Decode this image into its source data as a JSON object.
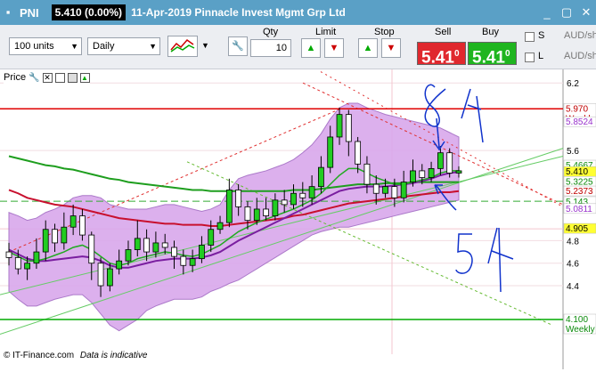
{
  "window": {
    "symbol": "PNI",
    "last": "5.410 (0.00%)",
    "title": "11-Apr-2019 Pinnacle Invest Mgmt Grp Ltd"
  },
  "toolbar": {
    "units": "100 units",
    "period": "Daily",
    "qty_label": "Qty",
    "qty_value": "10",
    "limit_label": "Limit",
    "stop_label": "Stop",
    "sell_label": "Sell",
    "buy_label": "Buy",
    "sell_price": "5.41",
    "sell_sup": "0",
    "buy_price": "5.41",
    "buy_sup": "0",
    "s_label": "S",
    "l_label": "L",
    "audsh1": "AUD/sh",
    "audsh2": "AUD/sh"
  },
  "chart_panel": {
    "label": "Price"
  },
  "chart_data": {
    "type": "line",
    "yticks": [
      {
        "v": 6.2,
        "label": "6.2"
      },
      {
        "v": 5.6,
        "label": "5.6"
      },
      {
        "v": 4.8,
        "label": "4.8"
      },
      {
        "v": 4.6,
        "label": "4.6"
      },
      {
        "v": 4.4,
        "label": "4.4"
      }
    ],
    "ylim": [
      3.95,
      6.32
    ],
    "level_boxes": [
      {
        "v": 5.97,
        "label": "5.970",
        "sub": "Weekly",
        "bg": "#ffffff",
        "fg": "#c00000"
      },
      {
        "v": 5.8524,
        "label": "5.8524",
        "bg": "#ffffff",
        "fg": "#9933cc"
      },
      {
        "v": 5.4667,
        "label": "5.4667",
        "bg": "#ffffff",
        "fg": "#0a8a0a"
      },
      {
        "v": 5.41,
        "label": "5.410",
        "bg": "#ffff33",
        "fg": "#000000"
      },
      {
        "v": 5.3225,
        "label": "5.3225",
        "bg": "#ffffff",
        "fg": "#0a8a0a"
      },
      {
        "v": 5.2373,
        "label": "5.2373",
        "bg": "#ffffff",
        "fg": "#c00000"
      },
      {
        "v": 5.143,
        "label": "5.143",
        "bg": "#ffffff",
        "fg": "#0a8a0a"
      },
      {
        "v": 5.0811,
        "label": "5.0811",
        "bg": "#ffffff",
        "fg": "#9933cc"
      },
      {
        "v": 4.905,
        "label": "4.905",
        "bg": "#ffff33",
        "fg": "#000000"
      },
      {
        "v": 4.1,
        "label": "4.100",
        "sub": "Weekly",
        "bg": "#ffffff",
        "fg": "#0a8a0a"
      }
    ],
    "candles": [
      [
        4.7,
        4.65,
        4.78,
        4.58
      ],
      [
        4.65,
        4.55,
        4.72,
        4.5
      ],
      [
        4.55,
        4.6,
        4.66,
        4.45
      ],
      [
        4.6,
        4.7,
        4.82,
        4.55
      ],
      [
        4.7,
        4.9,
        4.98,
        4.62
      ],
      [
        4.9,
        4.78,
        4.95,
        4.7
      ],
      [
        4.78,
        4.92,
        5.05,
        4.72
      ],
      [
        4.92,
        5.02,
        5.12,
        4.85
      ],
      [
        5.02,
        4.85,
        5.08,
        4.8
      ],
      [
        4.85,
        4.6,
        4.88,
        4.45
      ],
      [
        4.6,
        4.4,
        4.65,
        4.3
      ],
      [
        4.4,
        4.55,
        4.6,
        4.35
      ],
      [
        4.55,
        4.62,
        4.72,
        4.5
      ],
      [
        4.62,
        4.72,
        4.8,
        4.58
      ],
      [
        4.72,
        4.82,
        4.98,
        4.66
      ],
      [
        4.82,
        4.7,
        4.9,
        4.62
      ],
      [
        4.7,
        4.78,
        4.88,
        4.65
      ],
      [
        4.78,
        4.74,
        4.86,
        4.68
      ],
      [
        4.74,
        4.66,
        4.8,
        4.55
      ],
      [
        4.66,
        4.58,
        4.72,
        4.5
      ],
      [
        4.58,
        4.64,
        4.72,
        4.52
      ],
      [
        4.64,
        4.76,
        4.84,
        4.6
      ],
      [
        4.76,
        4.9,
        4.98,
        4.7
      ],
      [
        4.9,
        4.96,
        5.02,
        4.86
      ],
      [
        4.96,
        5.25,
        5.35,
        4.92
      ],
      [
        5.25,
        5.1,
        5.3,
        5.02
      ],
      [
        5.1,
        4.98,
        5.15,
        4.9
      ],
      [
        4.98,
        5.08,
        5.18,
        4.94
      ],
      [
        5.08,
        5.02,
        5.18,
        4.98
      ],
      [
        5.02,
        5.16,
        5.22,
        4.98
      ],
      [
        5.16,
        5.12,
        5.25,
        5.05
      ],
      [
        5.12,
        5.22,
        5.3,
        5.08
      ],
      [
        5.22,
        5.18,
        5.32,
        5.1
      ],
      [
        5.18,
        5.28,
        5.38,
        5.12
      ],
      [
        5.28,
        5.45,
        5.55,
        5.22
      ],
      [
        5.45,
        5.72,
        5.82,
        5.4
      ],
      [
        5.72,
        5.92,
        5.98,
        5.65
      ],
      [
        5.92,
        5.68,
        5.96,
        5.55
      ],
      [
        5.68,
        5.48,
        5.72,
        5.4
      ],
      [
        5.48,
        5.3,
        5.55,
        5.22
      ],
      [
        5.3,
        5.22,
        5.38,
        5.12
      ],
      [
        5.22,
        5.28,
        5.35,
        5.18
      ],
      [
        5.28,
        5.18,
        5.35,
        5.1
      ],
      [
        5.18,
        5.32,
        5.42,
        5.14
      ],
      [
        5.32,
        5.42,
        5.52,
        5.28
      ],
      [
        5.42,
        5.36,
        5.48,
        5.3
      ],
      [
        5.36,
        5.44,
        5.5,
        5.32
      ],
      [
        5.44,
        5.58,
        5.64,
        5.38
      ],
      [
        5.58,
        5.4,
        5.62,
        5.36
      ],
      [
        5.4,
        5.42,
        5.46,
        5.36
      ]
    ],
    "ma_green": [
      5.55,
      5.53,
      5.51,
      5.49,
      5.47,
      5.46,
      5.44,
      5.43,
      5.41,
      5.39,
      5.37,
      5.35,
      5.34,
      5.32,
      5.31,
      5.3,
      5.29,
      5.28,
      5.27,
      5.26,
      5.25,
      5.25,
      5.24,
      5.24,
      5.24,
      5.24,
      5.24,
      5.24,
      5.24,
      5.24,
      5.24,
      5.25,
      5.25,
      5.25,
      5.26,
      5.27,
      5.28,
      5.29,
      5.3,
      5.3,
      5.3,
      5.31,
      5.31,
      5.31,
      5.32,
      5.32,
      5.32,
      5.32,
      5.32,
      5.32
    ],
    "ma_red": [
      5.25,
      5.22,
      5.18,
      5.16,
      5.14,
      5.12,
      5.11,
      5.1,
      5.08,
      5.06,
      5.04,
      5.02,
      5.0,
      4.99,
      4.98,
      4.97,
      4.96,
      4.95,
      4.95,
      4.94,
      4.94,
      4.94,
      4.93,
      4.93,
      4.94,
      4.95,
      4.96,
      4.97,
      4.98,
      4.99,
      5.0,
      5.02,
      5.03,
      5.05,
      5.07,
      5.09,
      5.11,
      5.13,
      5.14,
      5.15,
      5.16,
      5.17,
      5.18,
      5.19,
      5.2,
      5.21,
      5.22,
      5.23,
      5.23,
      5.24
    ],
    "ma_purple": [
      4.72,
      4.68,
      4.64,
      4.62,
      4.62,
      4.63,
      4.64,
      4.65,
      4.66,
      4.65,
      4.62,
      4.58,
      4.56,
      4.56,
      4.58,
      4.6,
      4.62,
      4.63,
      4.64,
      4.64,
      4.64,
      4.65,
      4.67,
      4.7,
      4.75,
      4.8,
      4.84,
      4.88,
      4.92,
      4.96,
      5.0,
      5.04,
      5.08,
      5.12,
      5.16,
      5.2,
      5.24,
      5.26,
      5.27,
      5.28,
      5.28,
      5.28,
      5.29,
      5.3,
      5.31,
      5.33,
      5.35,
      5.38,
      5.4,
      5.41
    ],
    "ma_green_fast": [
      4.7,
      4.66,
      4.62,
      4.62,
      4.64,
      4.67,
      4.7,
      4.74,
      4.76,
      4.72,
      4.66,
      4.6,
      4.58,
      4.6,
      4.64,
      4.66,
      4.68,
      4.7,
      4.69,
      4.67,
      4.66,
      4.68,
      4.72,
      4.76,
      4.82,
      4.88,
      4.92,
      4.96,
      4.99,
      5.02,
      5.05,
      5.08,
      5.12,
      5.16,
      5.22,
      5.3,
      5.38,
      5.44,
      5.44,
      5.4,
      5.36,
      5.33,
      5.3,
      5.3,
      5.32,
      5.34,
      5.36,
      5.4,
      5.42,
      5.42
    ],
    "bb_upper": [
      5.05,
      5.02,
      4.98,
      5.0,
      5.05,
      5.08,
      5.12,
      5.18,
      5.2,
      5.2,
      5.18,
      5.12,
      5.1,
      5.08,
      5.08,
      5.08,
      5.1,
      5.12,
      5.12,
      5.1,
      5.08,
      5.06,
      5.08,
      5.12,
      5.25,
      5.35,
      5.38,
      5.4,
      5.42,
      5.45,
      5.48,
      5.52,
      5.58,
      5.65,
      5.75,
      5.88,
      5.98,
      6.02,
      6.02,
      5.98,
      5.95,
      5.92,
      5.9,
      5.88,
      5.86,
      5.84,
      5.82,
      5.8,
      5.76,
      5.72
    ],
    "bb_lower": [
      4.35,
      4.28,
      4.22,
      4.22,
      4.25,
      4.28,
      4.3,
      4.32,
      4.32,
      4.25,
      4.15,
      4.05,
      4.0,
      4.05,
      4.1,
      4.18,
      4.22,
      4.25,
      4.28,
      4.28,
      4.28,
      4.3,
      4.35,
      4.38,
      4.42,
      4.45,
      4.5,
      4.55,
      4.6,
      4.65,
      4.7,
      4.75,
      4.8,
      4.85,
      4.88,
      4.9,
      4.92,
      4.92,
      4.94,
      4.96,
      4.98,
      5.0,
      5.02,
      5.04,
      5.06,
      5.08,
      5.1,
      5.12,
      5.14,
      5.16
    ],
    "levels": {
      "resistance": 5.97,
      "support": 4.1,
      "dashed_green": 5.15,
      "pink_h": 4.905
    }
  },
  "annotations": {
    "top": "8/4",
    "bottom": "5/4"
  },
  "footer": {
    "copyright": "© IT-Finance.com",
    "note": "Data is indicative"
  }
}
